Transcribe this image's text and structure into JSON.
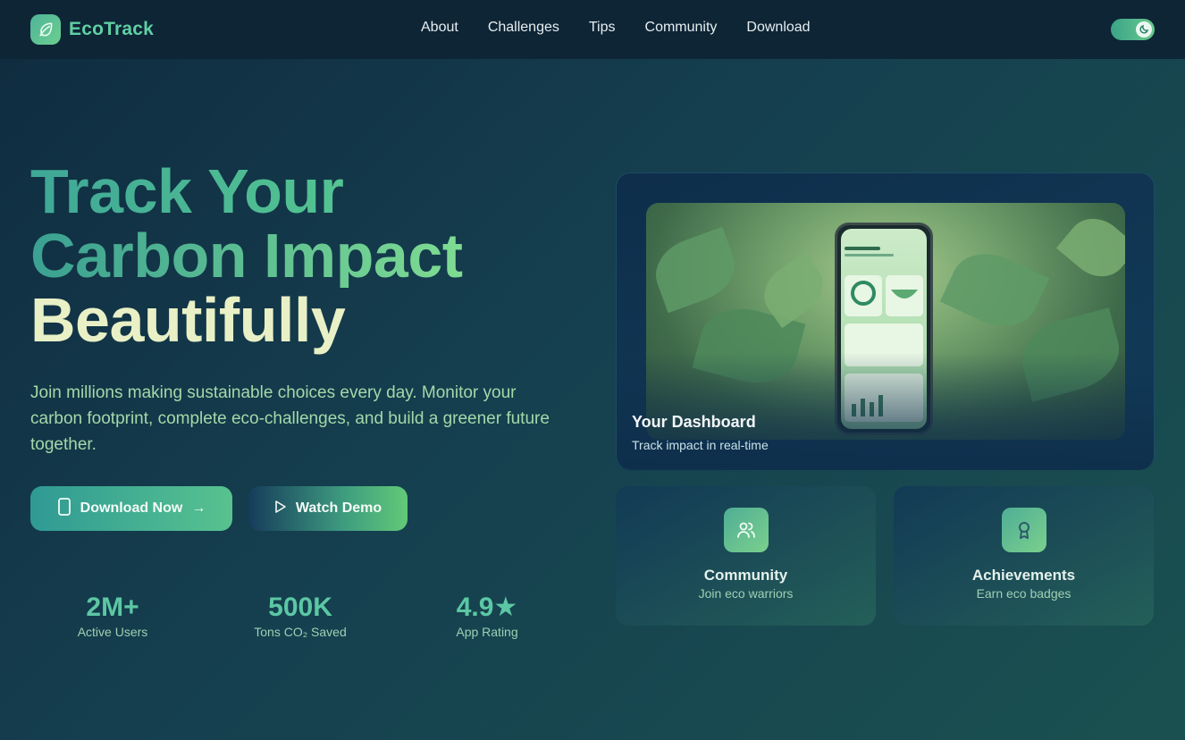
{
  "brand": {
    "name": "EcoTrack",
    "logo_icon": "leaf-icon"
  },
  "nav": {
    "links": [
      "About",
      "Challenges",
      "Tips",
      "Community",
      "Download"
    ],
    "theme_toggle_icon": "moon-icon"
  },
  "hero": {
    "line1": "Track Your",
    "line2": "Carbon Impact",
    "line3": "Beautifully",
    "subtitle": "Join millions making sustainable choices every day. Monitor your carbon footprint, complete eco-challenges, and build a greener future together.",
    "download_button": {
      "label": "Download Now",
      "icon": "phone-icon",
      "trail_icon": "arrow-right-icon",
      "arrow": "→"
    },
    "demo_button": {
      "label": "Watch Demo",
      "icon": "play-icon"
    }
  },
  "stats": [
    {
      "value": "2M+",
      "label": "Active Users"
    },
    {
      "value": "500K",
      "label": "Tons CO₂ Saved"
    },
    {
      "value": "4.9★",
      "label": "App Rating"
    }
  ],
  "dashboard": {
    "title": "Your Dashboard",
    "subtitle": "Track impact in real-time"
  },
  "features": [
    {
      "title": "Community",
      "subtitle": "Join eco warriors",
      "icon": "users-icon"
    },
    {
      "title": "Achievements",
      "subtitle": "Earn eco badges",
      "icon": "award-icon"
    }
  ],
  "colors": {
    "accent": "#5cc7a4",
    "headline_cream": "#e9f0c6",
    "nav_bg": "#0e2536"
  }
}
